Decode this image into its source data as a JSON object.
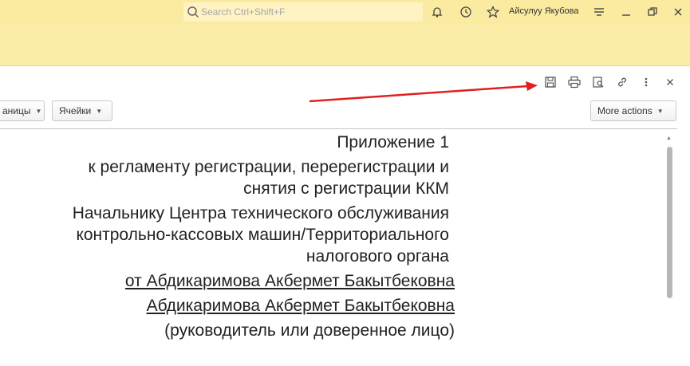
{
  "topbar": {
    "search_placeholder": "Search Ctrl+Shift+F",
    "user_name": "Айсулуу Якубова"
  },
  "toolbar": {
    "buttons": [
      {
        "label": "аницы"
      },
      {
        "label": "Ячейки"
      },
      {
        "label": "More actions"
      }
    ]
  },
  "document": {
    "lines": [
      "Приложение 1",
      "к регламенту регистрации, перерегистрации и",
      "снятия с регистрации ККМ",
      "Начальнику Центра технического обслуживания",
      "контрольно-кассовых машин/Территориального",
      "налогового органа",
      "от Абдикаримова Акбермет Бакытбековна",
      "Абдикаримова Акбермет Бакытбековна",
      "(руководитель или доверенное лицо)"
    ]
  },
  "colors": {
    "topbar": "#fbeba1",
    "annotation_arrow": "#e02020"
  }
}
